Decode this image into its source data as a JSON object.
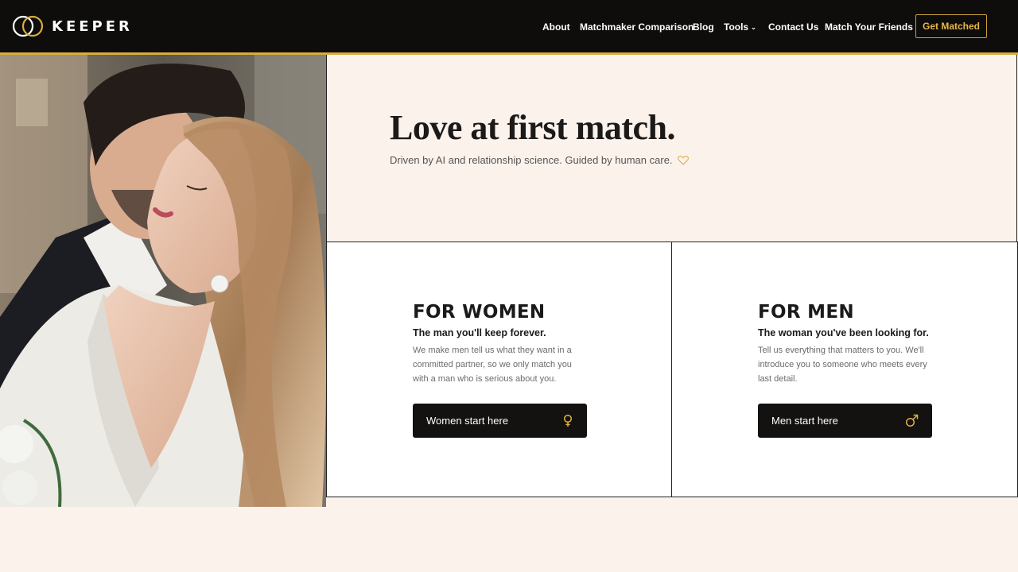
{
  "brand": {
    "name": "KEEPER"
  },
  "nav": {
    "items": [
      {
        "label": "About"
      },
      {
        "label": "Matchmaker Comparison"
      },
      {
        "label": "Blog"
      },
      {
        "label": "Tools"
      },
      {
        "label": "Contact Us"
      },
      {
        "label": "Match Your Friends"
      }
    ],
    "cta_label": "Get Matched"
  },
  "hero": {
    "title": "Love at first match.",
    "subtitle": "Driven by AI and relationship science. Guided by human care."
  },
  "cards": {
    "women": {
      "title": "FOR WOMEN",
      "subtitle": "The man you'll keep forever.",
      "description": "We make men tell us what they want in a committed partner, so we only match you with a man who is serious about you.",
      "button_label": "Women start here",
      "icon": "female-symbol-icon"
    },
    "men": {
      "title": "FOR MEN",
      "subtitle": "The woman you've been looking for.",
      "description": "Tell us everything that matters to you. We'll introduce you to someone who meets every last detail.",
      "button_label": "Men start here",
      "icon": "male-symbol-icon"
    }
  },
  "colors": {
    "accent": "#d9ad3c",
    "header_bg": "#0e0d0c",
    "page_bg": "#fbf2ec",
    "button_bg": "#131211"
  }
}
